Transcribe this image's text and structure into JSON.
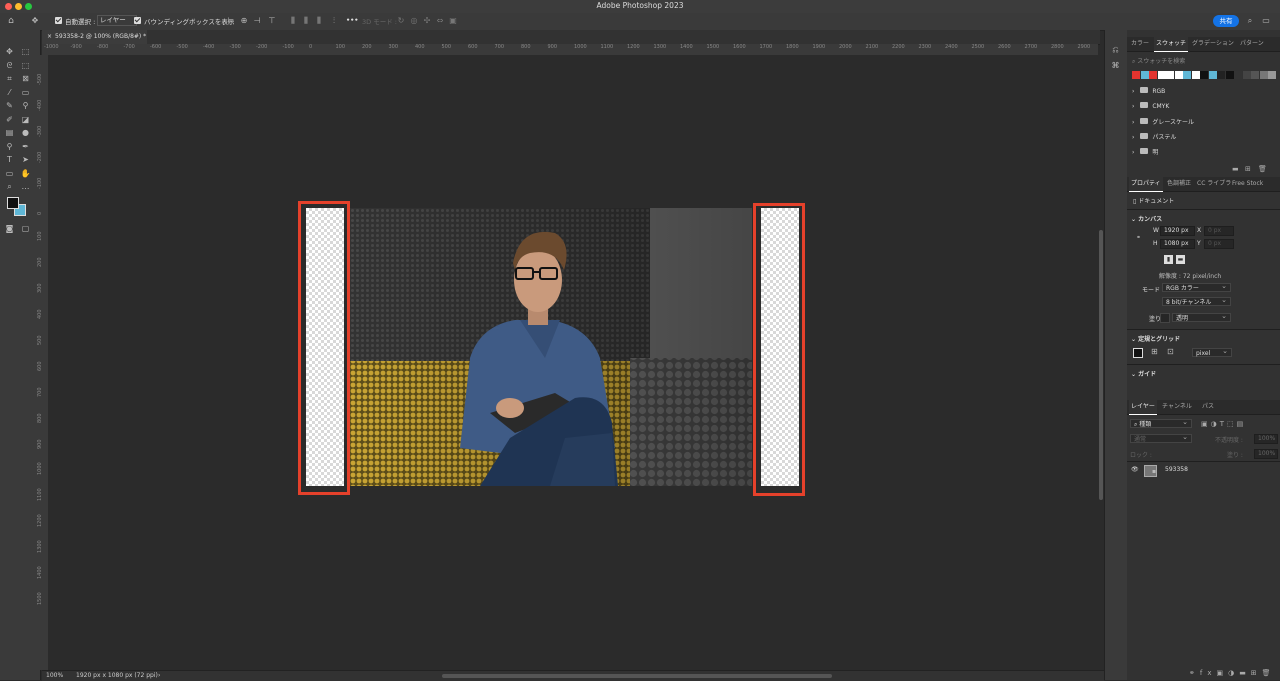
{
  "app": {
    "title": "Adobe Photoshop 2023"
  },
  "options_bar": {
    "auto_select_label": "自動選択 :",
    "layer_select_value": "レイヤー",
    "bounding_box_label": "バウンディングボックスを表示",
    "mode_3d_label": "3D モード :",
    "more_label": "•••",
    "share_label": "共有"
  },
  "document": {
    "tab_label": "593358-2 @ 100% (RGB/8#) *",
    "zoom": "100%",
    "status": "1920 px x 1080 px (72 ppi)"
  },
  "ruler": {
    "h_ticks": [
      "-1000",
      "-900",
      "-800",
      "-700",
      "-600",
      "-500",
      "-400",
      "-300",
      "-200",
      "-100",
      "0",
      "100",
      "200",
      "300",
      "400",
      "500",
      "600",
      "700",
      "800",
      "900",
      "1000",
      "1100",
      "1200",
      "1300",
      "1400",
      "1500",
      "1600",
      "1700",
      "1800",
      "1900",
      "2000",
      "2100",
      "2200",
      "2300",
      "2400",
      "2500",
      "2600",
      "2700",
      "2800",
      "2900"
    ],
    "v_ticks": [
      "-500",
      "-400",
      "-300",
      "-200",
      "-100",
      "0",
      "100",
      "200",
      "300",
      "400",
      "500",
      "600",
      "700",
      "800",
      "900",
      "1000",
      "1100",
      "1200",
      "1300",
      "1400",
      "1500"
    ]
  },
  "swatches_panel": {
    "tabs": [
      "カラー",
      "スウォッチ",
      "グラデーション",
      "パターン"
    ],
    "active_tab": "スウォッチ",
    "search_placeholder": "スウォッチを検索",
    "colors": [
      "#e3342f",
      "#5fb7d6",
      "#e3342f",
      "#ffffff",
      "#ffffff",
      "#ffffff",
      "#5fb7d6",
      "#ffffff",
      "#111111",
      "#5fb7d6",
      "#222222",
      "#111111",
      "#333333",
      "#444444",
      "#555555",
      "#777777",
      "#999999"
    ],
    "groups": [
      "RGB",
      "CMYK",
      "グレースケール",
      "パステル",
      "明"
    ]
  },
  "properties_panel": {
    "tabs": [
      "プロパティ",
      "色調補正",
      "CC ライブラ",
      "Free Stock"
    ],
    "active_tab": "プロパティ",
    "doc_label": "ドキュメント",
    "canvas_section": "カンバス",
    "w_label": "W",
    "w_value": "1920 px",
    "h_label": "H",
    "h_value": "1080 px",
    "x_label": "X",
    "x_value": "0 px",
    "y_label": "Y",
    "y_value": "0 px",
    "resolution": "解像度 : 72 pixel/inch",
    "mode_label": "モード",
    "mode_value": "RGB カラー",
    "bit_value": "8 bit/チャンネル",
    "fill_label": "塗り",
    "fill_value": "透明",
    "rulers_section": "定規とグリッド",
    "unit_value": "pixel",
    "guides_section": "ガイド"
  },
  "layers_panel": {
    "tabs": [
      "レイヤー",
      "チャンネル",
      "パス"
    ],
    "active_tab": "レイヤー",
    "kind_value": "種類",
    "blend_value": "通常",
    "opacity_label": "不透明度 :",
    "opacity_value": "100%",
    "lock_label": "ロック :",
    "fill_label": "塗り :",
    "fill_value": "100%",
    "layer_name": "593358"
  }
}
